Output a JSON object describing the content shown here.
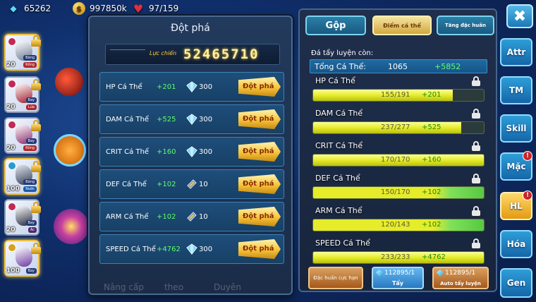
{
  "top_bar": {
    "gems": "65262",
    "gold": "997850k",
    "stamina": "97/159"
  },
  "roster": [
    {
      "level": "20",
      "tag1": "Băng",
      "tag2": "Rồng",
      "rank": "1"
    },
    {
      "level": "20",
      "tag1": "Bay",
      "tag2": "Lửa",
      "rank": "1"
    },
    {
      "level": "20",
      "tag1": "Bay",
      "tag2": "Rồng",
      "rank": "1"
    },
    {
      "level": "100",
      "tag1": "Băng",
      "tag2": "Nước",
      "rank": "1"
    },
    {
      "level": "20",
      "tag1": "Bay",
      "tag2": "Ác",
      "rank": "1"
    },
    {
      "level": "100",
      "tag1": "",
      "tag2": "Bay",
      "rank": "1"
    }
  ],
  "background": {
    "label_upgrade": "Nâng cấp",
    "label_follow": "theo",
    "label_fate": "Duyên"
  },
  "break_panel": {
    "title": "Đột phá",
    "power_label": "Lực chiến",
    "power_value": "52465710",
    "rows": [
      {
        "name": "HP Cá Thể",
        "bonus": "+201",
        "cost_icon": "diamond-icon",
        "cost": "300",
        "button": "Đột phá"
      },
      {
        "name": "DAM Cá Thể",
        "bonus": "+525",
        "cost_icon": "diamond-icon",
        "cost": "300",
        "button": "Đột phá"
      },
      {
        "name": "CRIT Cá Thể",
        "bonus": "+160",
        "cost_icon": "diamond-icon",
        "cost": "300",
        "button": "Đột phá"
      },
      {
        "name": "DEF Cá Thể",
        "bonus": "+102",
        "cost_icon": "crystal-icon",
        "cost": "10",
        "button": "Đột phá"
      },
      {
        "name": "ARM Cá Thể",
        "bonus": "+102",
        "cost_icon": "crystal-icon",
        "cost": "10",
        "button": "Đột phá"
      },
      {
        "name": "SPEED Cá Thể",
        "bonus": "+4762",
        "cost_icon": "diamond-icon",
        "cost": "300",
        "button": "Đột phá"
      }
    ]
  },
  "iv_panel": {
    "tabs": {
      "merge": "Gộp",
      "iv": "Điểm cá thể",
      "reward": "Tăng đặc huấn"
    },
    "remain_label": "Đá tẩy luyện còn:",
    "total": {
      "label": "Tổng Cá Thể:",
      "value": "1065",
      "bonus": "+5852"
    },
    "stats": [
      {
        "name": "HP Cá Thể",
        "value": "155/191",
        "bonus": "+201",
        "fill": 0.81,
        "green": false
      },
      {
        "name": "DAM Cá Thể",
        "value": "237/277",
        "bonus": "+525",
        "fill": 0.86,
        "green": false
      },
      {
        "name": "CRIT Cá Thể",
        "value": "170/170",
        "bonus": "+160",
        "fill": 1.0,
        "green": false
      },
      {
        "name": "DEF Cá Thể",
        "value": "150/170",
        "bonus": "+102",
        "fill": 1.0,
        "green": true
      },
      {
        "name": "ARM Cá Thể",
        "value": "120/143",
        "bonus": "+102",
        "fill": 1.0,
        "green": true
      },
      {
        "name": "SPEED Cá Thể",
        "value": "233/233",
        "bonus": "+4762",
        "fill": 1.0,
        "green": false
      }
    ],
    "buttons": {
      "special": "Đặc huấn cực hạn",
      "wash_count": "112895/1",
      "wash_label": "Tẩy",
      "auto_count": "112895/1",
      "auto_label": "Auto tẩy luyện"
    }
  },
  "side_menu": {
    "close": "✖",
    "items": [
      {
        "label": "Attr",
        "badge": ""
      },
      {
        "label": "TM",
        "badge": ""
      },
      {
        "label": "Skill",
        "badge": ""
      },
      {
        "label": "Mặc",
        "badge": "!"
      },
      {
        "label": "HL",
        "badge": "!"
      },
      {
        "label": "Hóa",
        "badge": ""
      },
      {
        "label": "Gen",
        "badge": ""
      }
    ]
  },
  "colors": {
    "bonus_green": "#5dff6a",
    "gold_button": "#f5c33a",
    "panel_blue": "#1e4e7a"
  }
}
